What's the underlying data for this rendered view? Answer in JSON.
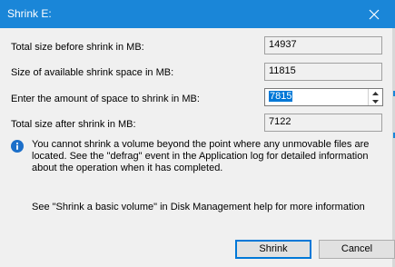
{
  "window": {
    "title": "Shrink E:",
    "title_bar_color": "#1a86d8"
  },
  "rows": [
    {
      "label": "Total size before shrink in MB:",
      "value": "14937"
    },
    {
      "label": "Size of available shrink space in MB:",
      "value": "11815"
    },
    {
      "label": "Enter the amount of space to shrink in MB:",
      "value": "7815"
    },
    {
      "label": "Total size after shrink in MB:",
      "value": "7122"
    }
  ],
  "info": {
    "icon": "info-icon",
    "text": "You cannot shrink a volume beyond the point where any unmovable files are located. See the \"defrag\" event in the Application log for detailed information about the operation when it has completed."
  },
  "help_text": "See \"Shrink a basic volume\" in Disk Management help for more information",
  "buttons": {
    "shrink": "Shrink",
    "cancel": "Cancel"
  },
  "colors": {
    "accent": "#0078d7",
    "dialog_bg": "#f0f0f0"
  }
}
